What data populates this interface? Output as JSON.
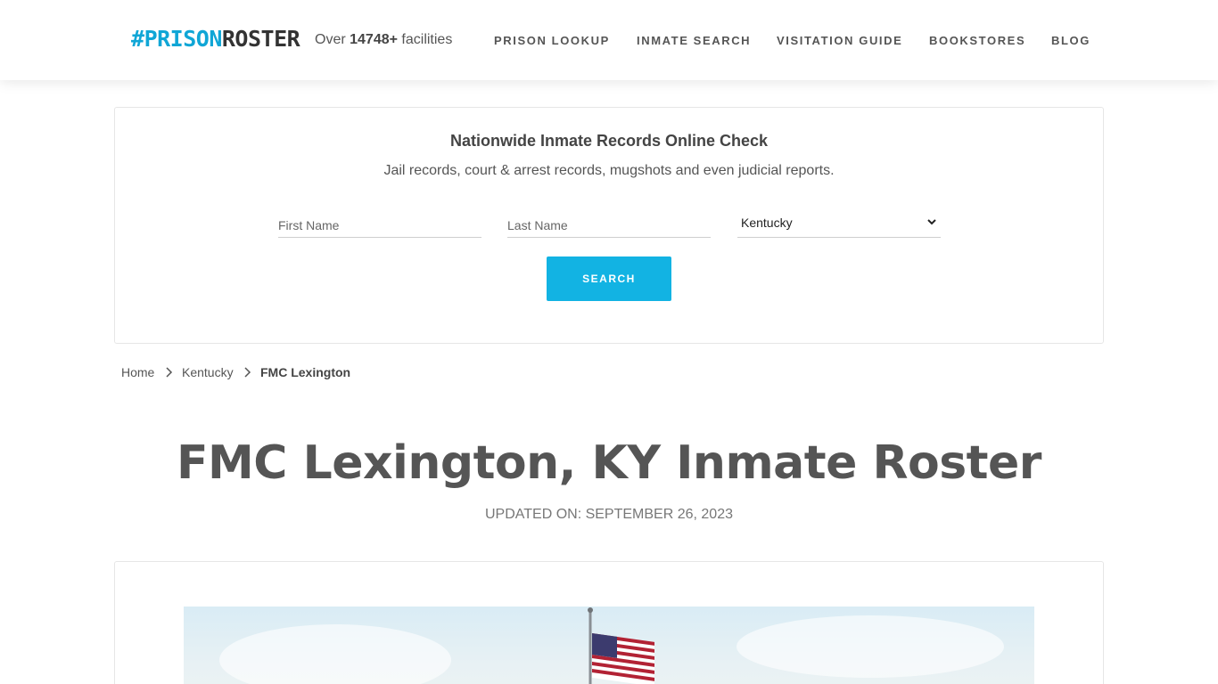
{
  "header": {
    "logo": {
      "hash": "#",
      "prison": "PRISON",
      "roster": "ROSTER"
    },
    "facilities": {
      "prefix": "Over ",
      "count": "14748+",
      "suffix": " facilities"
    },
    "nav": [
      {
        "label": "PRISON LOOKUP"
      },
      {
        "label": "INMATE SEARCH"
      },
      {
        "label": "VISITATION GUIDE"
      },
      {
        "label": "BOOKSTORES"
      },
      {
        "label": "BLOG"
      }
    ]
  },
  "search": {
    "title": "Nationwide Inmate Records Online Check",
    "subtitle": "Jail records, court & arrest records, mugshots and even judicial reports.",
    "first_name_placeholder": "First Name",
    "last_name_placeholder": "Last Name",
    "state_selected": "Kentucky",
    "button_label": "SEARCH"
  },
  "breadcrumb": [
    {
      "label": "Home"
    },
    {
      "label": "Kentucky"
    },
    {
      "label": "FMC Lexington"
    }
  ],
  "page": {
    "title": "FMC Lexington, KY Inmate Roster",
    "updated": "UPDATED ON: SEPTEMBER 26, 2023"
  },
  "colors": {
    "accent": "#12b3e3",
    "logo_blue": "#10a6d6",
    "text": "#555555"
  },
  "icons": {
    "breadcrumb_separator": "chevron-right-icon",
    "select_arrow": "chevron-down-icon"
  }
}
